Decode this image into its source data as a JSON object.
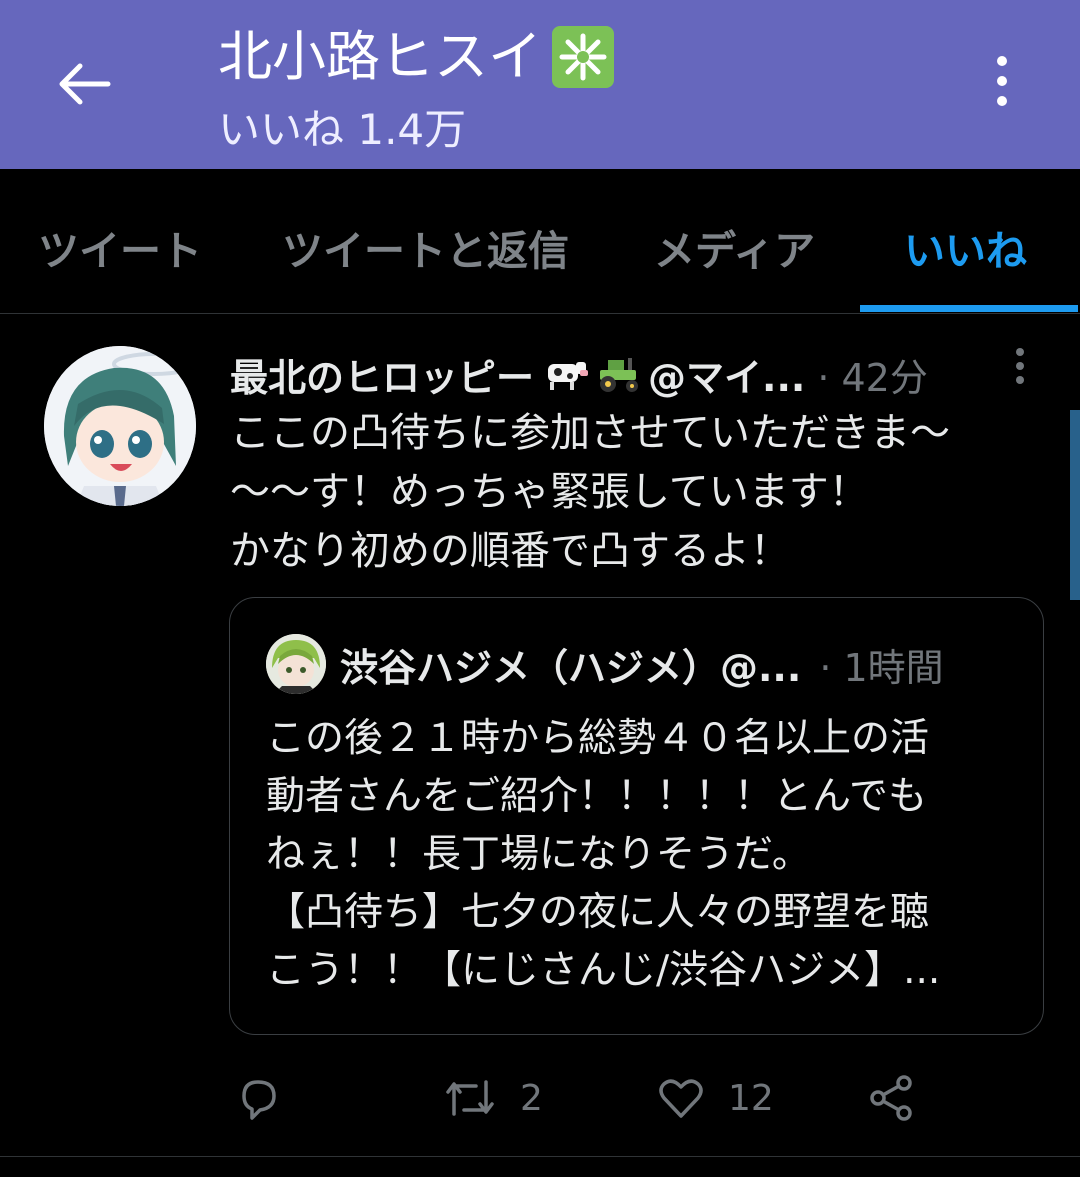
{
  "header": {
    "title": "北小路ヒスイ",
    "subtitle": "いいね 1.4万",
    "back_icon": "arrow-left-icon",
    "menu_icon": "kebab-menu-icon",
    "background": "#6667bd"
  },
  "tabs": [
    {
      "label": "ツイート",
      "active": false
    },
    {
      "label": "ツイートと返信",
      "active": false
    },
    {
      "label": "メディア",
      "active": false
    },
    {
      "label": "いいね",
      "active": true
    }
  ],
  "tweet": {
    "name": "最北のヒロッピー",
    "handle": "@マイ...",
    "time": "· 42分",
    "text_lines": [
      "ここの凸待ちに参加させていただきま〜",
      "〜〜す！めっちゃ緊張しています！",
      "かなり初めの順番で凸するよ！"
    ],
    "quote": {
      "name": "渋谷ハジメ（ハジメ）@...",
      "time": "· 1時間",
      "text_lines": [
        "この後２１時から総勢４０名以上の活",
        "動者さんをご紹介！！！！！とんでも",
        "ねぇ！！長丁場になりそうだ。",
        "【凸待ち】七夕の夜に人々の野望を聴",
        "こう！！【にじさんじ/渋谷ハジメ】..."
      ]
    },
    "actions": {
      "reply_count": "",
      "retweet_count": "2",
      "like_count": "12"
    }
  },
  "colors": {
    "accent": "#1d9bf0",
    "muted": "#71767b",
    "text": "#e7e9ea"
  }
}
